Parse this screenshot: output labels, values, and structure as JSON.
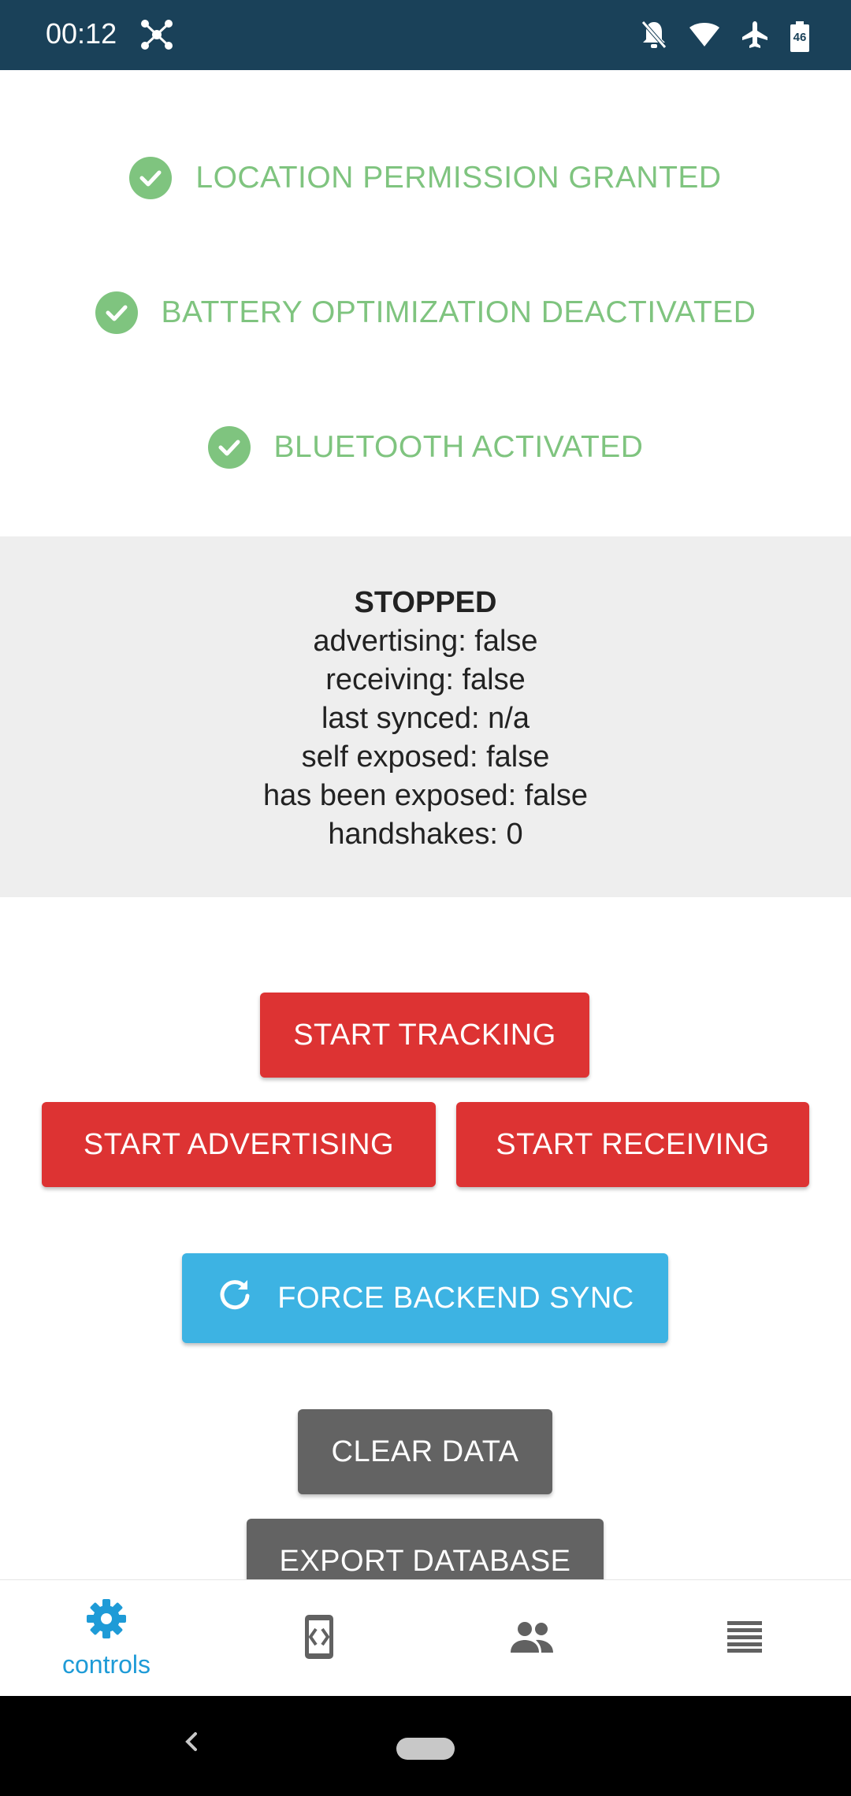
{
  "status_bar": {
    "time": "00:12",
    "icons": [
      "network-icon",
      "notifications-off-icon",
      "wifi-icon",
      "airplane-icon",
      "battery-icon"
    ],
    "battery_level": "46"
  },
  "permissions": [
    {
      "label": "LOCATION PERMISSION GRANTED",
      "icon": "check-circle-icon"
    },
    {
      "label": "BATTERY OPTIMIZATION DEACTIVATED",
      "icon": "check-circle-icon"
    },
    {
      "label": "BLUETOOTH ACTIVATED",
      "icon": "check-circle-icon"
    }
  ],
  "status_panel": {
    "title": "STOPPED",
    "advertising": "advertising: false",
    "receiving": "receiving: false",
    "last_synced": "last synced: n/a",
    "self_exposed": "self exposed: false",
    "has_been_exposed": "has been exposed: false",
    "handshakes": "handshakes: 0"
  },
  "buttons": {
    "start_tracking": "START TRACKING",
    "start_advertising": "START ADVERTISING",
    "start_receiving": "START RECEIVING",
    "force_sync": "FORCE BACKEND SYNC",
    "clear_data": "CLEAR DATA",
    "export_database": "EXPORT DATABASE"
  },
  "bottom_nav": {
    "items": [
      {
        "label": "controls",
        "icon": "gear-icon",
        "active": true
      },
      {
        "label": "",
        "icon": "developer-icon",
        "active": false
      },
      {
        "label": "",
        "icon": "people-icon",
        "active": false
      },
      {
        "label": "",
        "icon": "list-icon",
        "active": false
      }
    ]
  },
  "colors": {
    "status_bar": "#1a4159",
    "success": "#7fc47f",
    "danger": "#dd3333",
    "primary": "#3db3e3",
    "neutral": "#636363",
    "accent": "#1e9bd7"
  }
}
